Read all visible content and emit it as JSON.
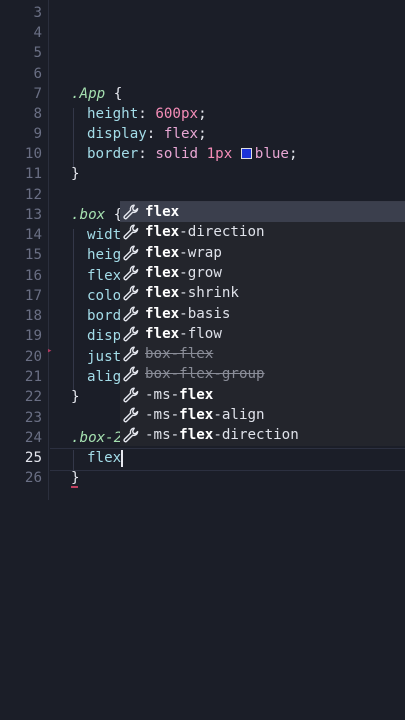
{
  "editor": {
    "line_numbers": [
      "3",
      "4",
      "5",
      "6",
      "7",
      "8",
      "9",
      "10",
      "11",
      "12",
      "13",
      "14",
      "15",
      "16",
      "17",
      "18",
      "19",
      "20",
      "21",
      "22",
      "23",
      "24",
      "25",
      "26"
    ],
    "active_line": "25",
    "app_rule": {
      "selector": ".App",
      "open": " {",
      "height_prop": "height",
      "height_val": "600px",
      "display_prop": "display",
      "display_val": "flex",
      "border_prop": "border",
      "border_val_1": "solid",
      "border_val_2": "1px",
      "border_color": "blue",
      "border_swatch_color": "#1c33d6",
      "close": "}"
    },
    "box_rule": {
      "selector": ".box",
      "open": " {",
      "lines": [
        "widt",
        "heig",
        "flex",
        "colo",
        "bord",
        "disp",
        "just",
        "alig"
      ],
      "close": "}"
    },
    "box2_rule": {
      "selector": ".box-2",
      "typed": "flex",
      "close": "}"
    },
    "punct": {
      "colon": ":",
      "semicolon": ";",
      "space": " "
    }
  },
  "suggestions": {
    "icon": "wrench-icon",
    "items": [
      {
        "pre": "",
        "match": "flex",
        "post": "",
        "deprecated": false,
        "selected": true
      },
      {
        "pre": "",
        "match": "flex",
        "post": "-direction",
        "deprecated": false,
        "selected": false
      },
      {
        "pre": "",
        "match": "flex",
        "post": "-wrap",
        "deprecated": false,
        "selected": false
      },
      {
        "pre": "",
        "match": "flex",
        "post": "-grow",
        "deprecated": false,
        "selected": false
      },
      {
        "pre": "",
        "match": "flex",
        "post": "-shrink",
        "deprecated": false,
        "selected": false
      },
      {
        "pre": "",
        "match": "flex",
        "post": "-basis",
        "deprecated": false,
        "selected": false
      },
      {
        "pre": "",
        "match": "flex",
        "post": "-flow",
        "deprecated": false,
        "selected": false
      },
      {
        "text": "box-flex",
        "deprecated": true,
        "selected": false
      },
      {
        "text": "box-flex-group",
        "deprecated": true,
        "selected": false
      },
      {
        "pre": "-ms-",
        "match": "flex",
        "post": "",
        "deprecated": false,
        "selected": false
      },
      {
        "pre": "-ms-",
        "match": "flex",
        "post": "-align",
        "deprecated": false,
        "selected": false
      },
      {
        "pre": "-ms-",
        "match": "flex",
        "post": "-direction",
        "deprecated": false,
        "selected": false
      }
    ]
  }
}
